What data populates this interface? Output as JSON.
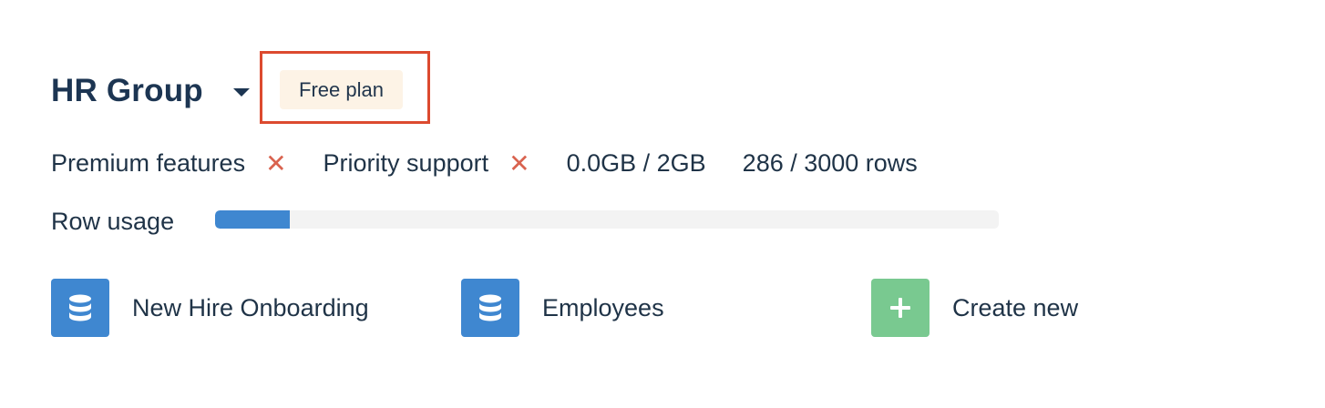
{
  "header": {
    "group_name": "HR Group",
    "plan_label": "Free plan"
  },
  "features": {
    "premium_label": "Premium features",
    "premium_enabled": false,
    "priority_label": "Priority support",
    "priority_enabled": false,
    "storage": "0.0GB / 2GB",
    "rows": "286 / 3000 rows"
  },
  "usage": {
    "label": "Row usage",
    "used": 286,
    "limit": 3000
  },
  "tiles": [
    {
      "label": "New Hire Onboarding",
      "icon": "database-icon"
    },
    {
      "label": "Employees",
      "icon": "database-icon"
    },
    {
      "label": "Create new",
      "icon": "plus-icon"
    }
  ],
  "colors": {
    "primary": "#3f87d0",
    "create": "#79c990",
    "cross": "#d9634f",
    "highlight": "#dc4a2f",
    "badge_bg": "#fdf3e6"
  }
}
